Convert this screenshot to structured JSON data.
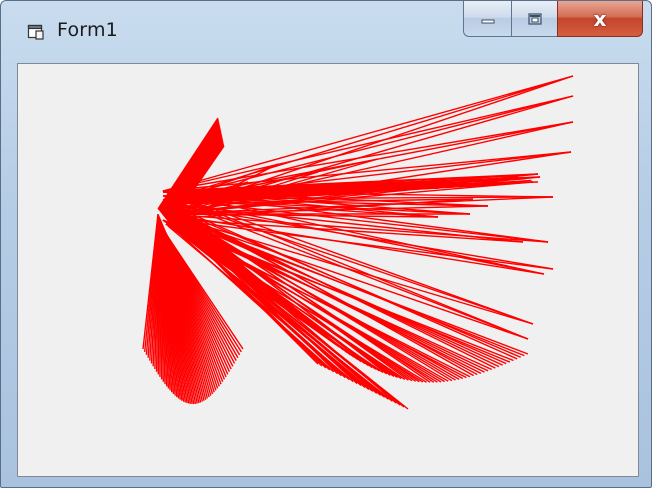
{
  "window": {
    "title": "Form1",
    "icon": "form-window-icon",
    "buttons": {
      "minimize_icon": "minimize-icon",
      "maximize_icon": "maximize-icon",
      "close_label": "x"
    }
  },
  "drawing": {
    "line_color": "#ff0000",
    "background": "#f0f0f0"
  }
}
